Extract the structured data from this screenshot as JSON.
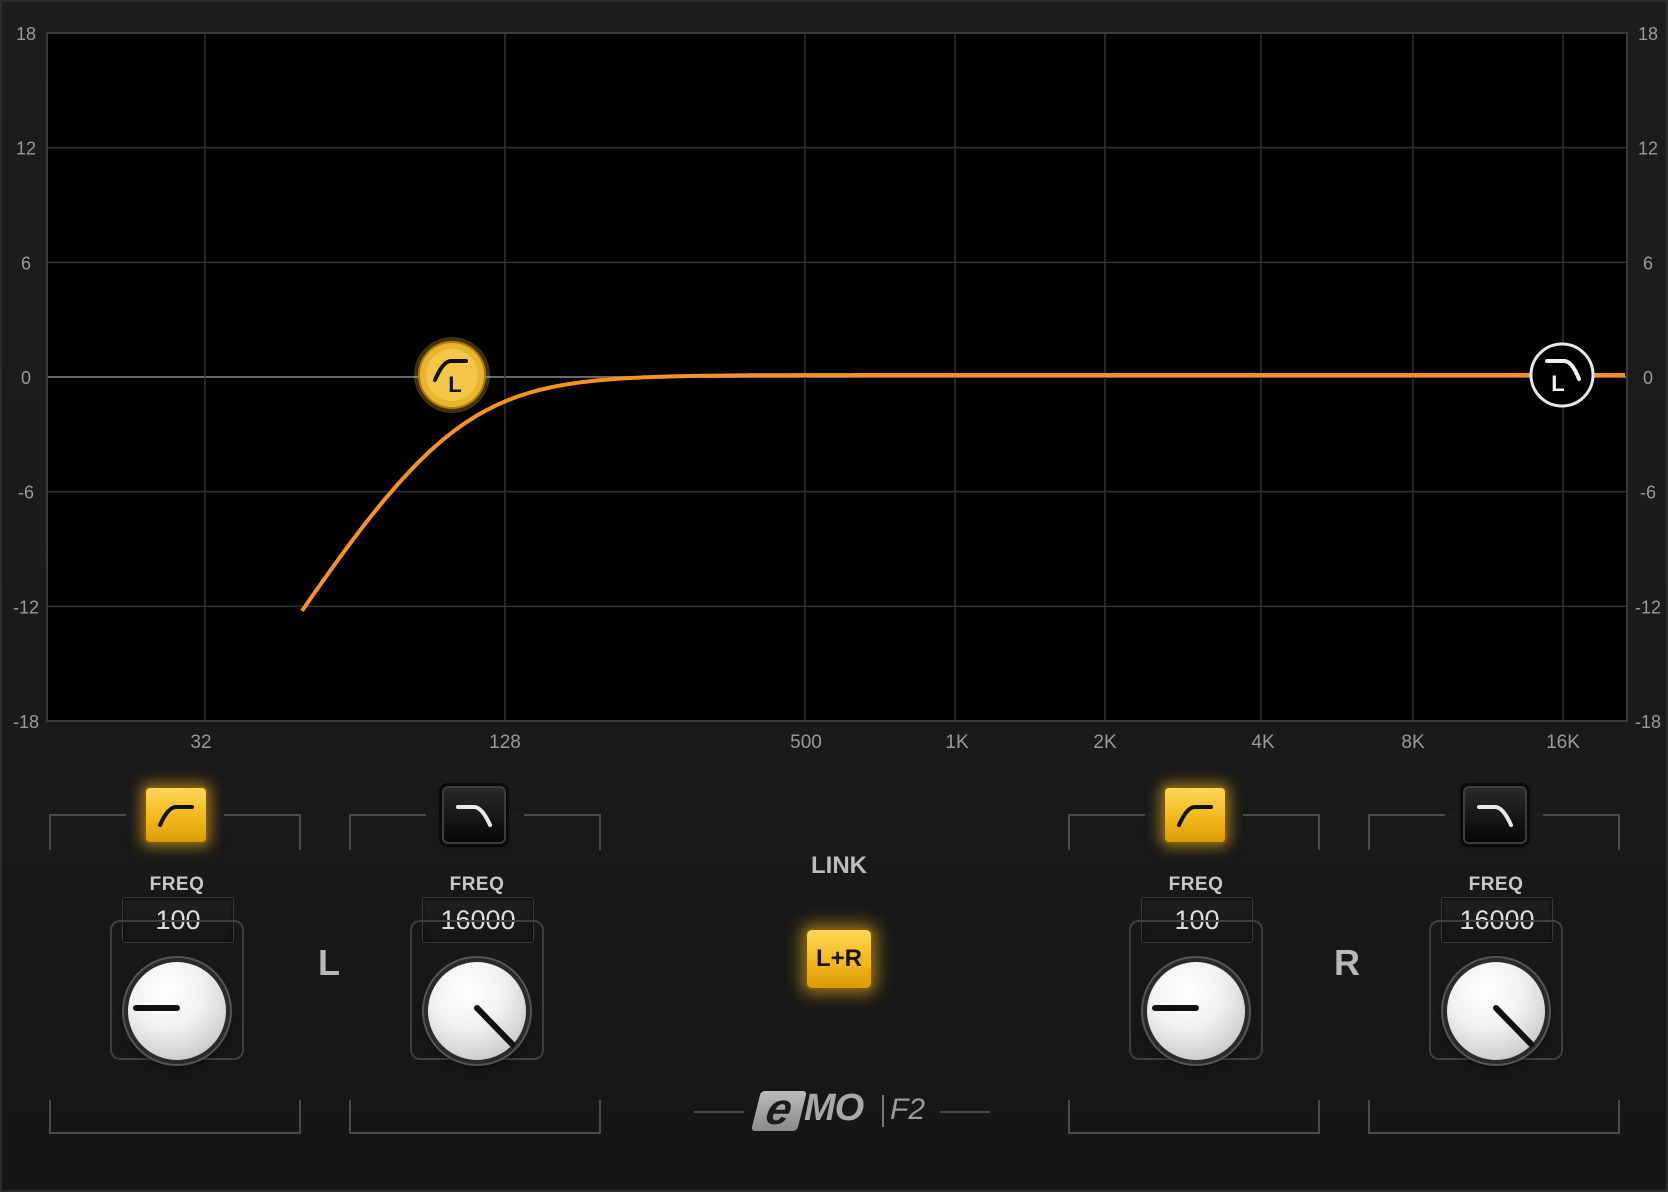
{
  "eq": {
    "db_ticks": [
      "18",
      "12",
      "6",
      "0",
      "-6",
      "-12",
      "-18"
    ],
    "freq_labels": [
      "32",
      "128",
      "500",
      "1K",
      "2K",
      "4K",
      "8K",
      "16K"
    ],
    "curve_color": "#f7931e",
    "handles": {
      "left_low_cut": {
        "letter": "L",
        "freq": 100,
        "active": true
      },
      "left_high_cut": {
        "letter": "L",
        "freq": 16000,
        "active": false
      }
    }
  },
  "left_channel": {
    "letter": "L",
    "low_cut": {
      "enabled": true,
      "freq_label": "FREQ",
      "freq_value": "100",
      "icon": "low-cut-icon"
    },
    "high_cut": {
      "enabled": false,
      "freq_label": "FREQ",
      "freq_value": "16000",
      "icon": "high-cut-icon"
    }
  },
  "right_channel": {
    "letter": "R",
    "low_cut": {
      "enabled": true,
      "freq_label": "FREQ",
      "freq_value": "100",
      "icon": "low-cut-icon"
    },
    "high_cut": {
      "enabled": false,
      "freq_label": "FREQ",
      "freq_value": "16000",
      "icon": "high-cut-icon"
    }
  },
  "link": {
    "label": "LINK",
    "button": "L+R",
    "active": true
  },
  "logo": {
    "brand_mark": "e",
    "brand": "MO",
    "model": "F2"
  },
  "colors": {
    "accent": "#f2b81c",
    "curve": "#f7931e",
    "background": "#1b1b1b"
  }
}
